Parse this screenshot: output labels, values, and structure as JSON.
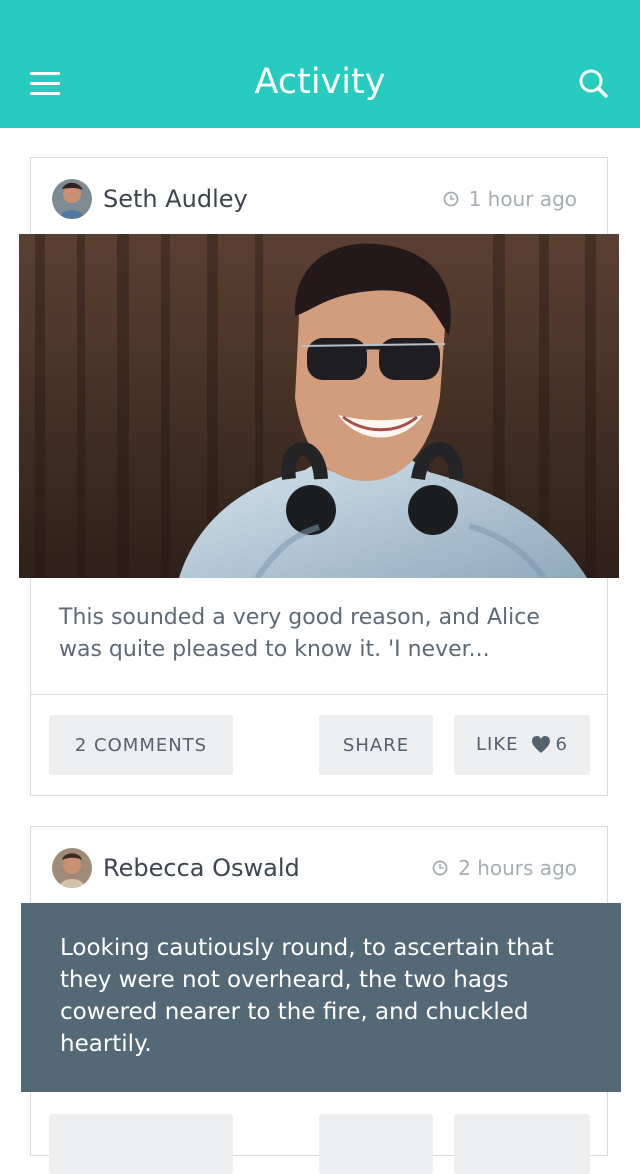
{
  "header": {
    "title": "Activity"
  },
  "posts": [
    {
      "author": "Seth Audley",
      "time": "1 hour ago",
      "text": "This sounded a very good reason, and Alice was quite pleased to know it. 'I never...",
      "comments_label": "2 COMMENTS",
      "share_label": "SHARE",
      "like_label": "LIKE",
      "like_count": "6"
    },
    {
      "author": "Rebecca Oswald",
      "time": "2 hours ago",
      "text": "Looking cautiously round, to ascertain that they were not overheard, the two hags cowered nearer to the fire, and chuckled heartily."
    }
  ],
  "colors": {
    "header": "#27cbc0",
    "quote_background": "#536978",
    "button_background": "#eceef0"
  },
  "icons": {
    "menu": "hamburger-menu-icon",
    "search": "search-icon",
    "time": "clock-icon",
    "like": "heart-icon"
  }
}
